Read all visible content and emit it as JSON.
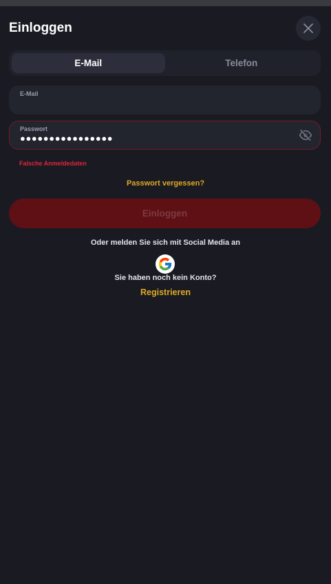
{
  "modal": {
    "title": "Einloggen"
  },
  "tabs": [
    {
      "label": "E-Mail",
      "active": true
    },
    {
      "label": "Telefon",
      "active": false
    }
  ],
  "email_field": {
    "label": "E-Mail",
    "value": ""
  },
  "password_field": {
    "label": "Passwort",
    "masked_value": "●●●●●●●●●●●●●●●●"
  },
  "error": {
    "message": "Falsche Anmeldedaten"
  },
  "forgot_password_label": "Passwort vergessen?",
  "login_button_label": "Einloggen",
  "social": {
    "prompt": "Oder melden Sie sich mit Social Media an",
    "providers": [
      "google-icon"
    ]
  },
  "register": {
    "prompt": "Sie haben noch kein Konto?",
    "link_label": "Registrieren"
  },
  "colors": {
    "background": "#1a1b22",
    "accent": "#e0a826",
    "error": "#e0243d",
    "login_button_bg": "#5e1015"
  }
}
